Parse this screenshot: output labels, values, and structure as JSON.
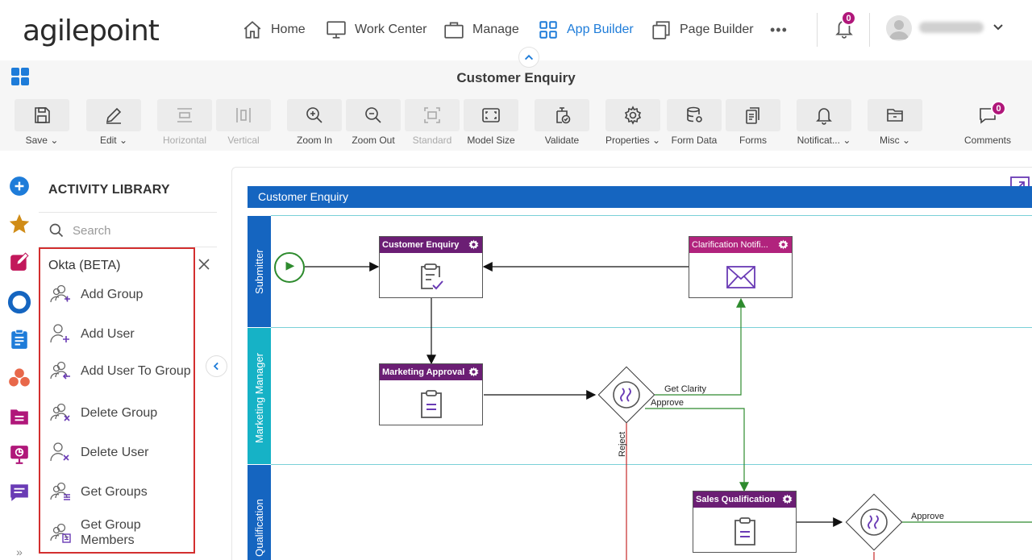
{
  "app": {
    "logo_text": "agilepoint",
    "nav": [
      {
        "label": "Home",
        "icon": "home-icon"
      },
      {
        "label": "Work Center",
        "icon": "monitor-icon"
      },
      {
        "label": "Manage",
        "icon": "briefcase-icon"
      },
      {
        "label": "App Builder",
        "icon": "app-grid-icon",
        "active": true
      },
      {
        "label": "Page Builder",
        "icon": "pages-icon"
      }
    ],
    "more_label": "•••",
    "notifications_count": "0",
    "accent_color": "#1e7cd9"
  },
  "page": {
    "title": "Customer Enquiry"
  },
  "toolbar": [
    {
      "label": "Save",
      "icon": "save-icon",
      "dropdown": true
    },
    {
      "label": "Edit",
      "icon": "pencil-icon",
      "dropdown": true
    },
    {
      "label": "Horizontal",
      "icon": "horizontal-icon",
      "disabled": true
    },
    {
      "label": "Vertical",
      "icon": "vertical-icon",
      "disabled": true
    },
    {
      "label": "Zoom In",
      "icon": "zoom-in-icon"
    },
    {
      "label": "Zoom Out",
      "icon": "zoom-out-icon"
    },
    {
      "label": "Standard",
      "icon": "standard-icon",
      "disabled": true
    },
    {
      "label": "Model Size",
      "icon": "model-size-icon"
    },
    {
      "label": "Validate",
      "icon": "validate-icon"
    },
    {
      "label": "Properties",
      "icon": "gear-icon",
      "dropdown": true
    },
    {
      "label": "Form Data",
      "icon": "database-icon"
    },
    {
      "label": "Forms",
      "icon": "forms-icon"
    },
    {
      "label": "Notificat...",
      "icon": "bell-icon",
      "dropdown": true
    },
    {
      "label": "Misc",
      "icon": "folder-icon",
      "dropdown": true
    },
    {
      "label": "Comments",
      "icon": "comment-icon",
      "badge": "0"
    }
  ],
  "library": {
    "title": "ACTIVITY LIBRARY",
    "search_placeholder": "Search",
    "group_title": "Okta (BETA)",
    "activities": [
      {
        "label": "Add Group",
        "icon": "add-group-icon"
      },
      {
        "label": "Add User",
        "icon": "add-user-icon"
      },
      {
        "label": "Add User To Group",
        "icon": "add-user-to-group-icon"
      },
      {
        "label": "Delete Group",
        "icon": "delete-group-icon"
      },
      {
        "label": "Delete User",
        "icon": "delete-user-icon"
      },
      {
        "label": "Get Groups",
        "icon": "get-groups-icon"
      },
      {
        "label": "Get Group Members",
        "icon": "get-group-members-icon"
      }
    ]
  },
  "diagram": {
    "pool_title": "Customer Enquiry",
    "lanes": [
      "Submitter",
      "Marketing Manager",
      "Sales Qualification"
    ],
    "nodes": [
      {
        "title": "Customer Enquiry",
        "type": "form"
      },
      {
        "title": "Clarification Notifi...",
        "type": "notification"
      },
      {
        "title": "Marketing Approval",
        "type": "approval"
      },
      {
        "title": "Sales Qualification",
        "type": "approval"
      }
    ],
    "edge_labels": [
      "Get Clarity",
      "Approve",
      "Reject",
      "Approve"
    ],
    "colors": {
      "pool": "#1565c0",
      "lane": "#16b2c6",
      "task_header": "#6b1e74",
      "notification_header": "#b1237d",
      "approve_edge": "#2e8b2e",
      "reject_edge": "#c62828"
    }
  }
}
